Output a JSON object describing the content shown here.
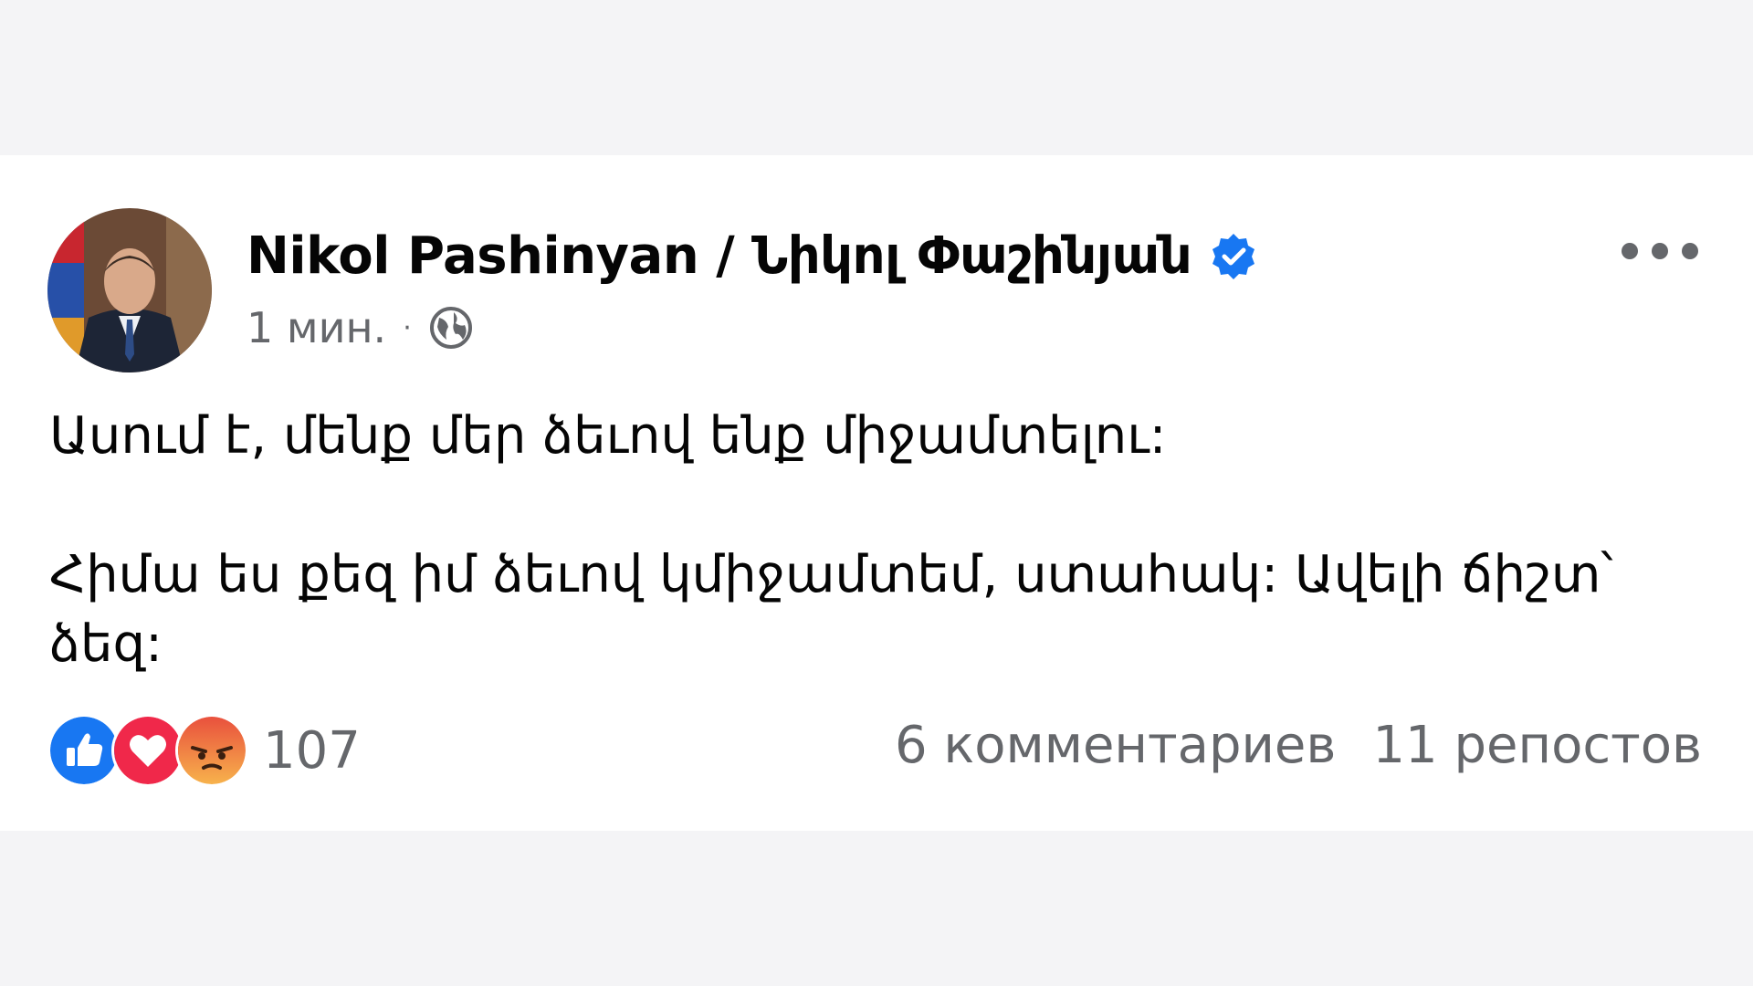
{
  "post": {
    "author": "Nikol Pashinyan / Նիկոլ Փաշինյան",
    "verified_icon": "verified-badge-icon",
    "time": "1 мин.",
    "separator": "·",
    "privacy_icon": "globe-icon",
    "more_icon": "more-options-icon",
    "paragraphs": [
      "Ասում է, մենք մեր ձեւով ենք միջամտելու:",
      "Հիմա ես քեզ իմ ձեւով կմիջամտեմ, ստահակ: Ավելի ճիշտ՝ ձեզ:"
    ]
  },
  "reactions": {
    "icons": [
      "like-icon",
      "love-icon",
      "angry-icon"
    ],
    "count": "107"
  },
  "engagement": {
    "comments": "6 комментариев",
    "shares": "11 репостов"
  },
  "colors": {
    "verified": "#1877f2",
    "like": "#1877f2",
    "love": "#f0284a",
    "angry": "#f7714c",
    "muted_text": "#65676b",
    "background": "#f4f4f6"
  }
}
